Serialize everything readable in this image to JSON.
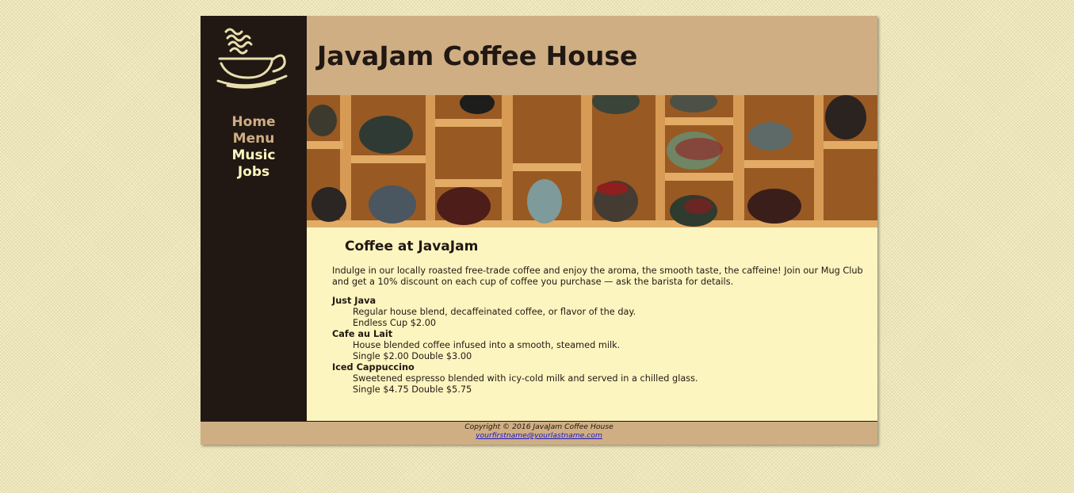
{
  "page": {
    "site_title": "JavaJam Coffee House"
  },
  "nav": {
    "items": [
      {
        "label": "Home",
        "state": "visited"
      },
      {
        "label": "Menu",
        "state": "visited"
      },
      {
        "label": "Music",
        "state": "unvisited"
      },
      {
        "label": "Jobs",
        "state": "unvisited"
      }
    ]
  },
  "hero": {
    "description": "mugs-on-wooden-shelves-photo"
  },
  "content": {
    "heading": "Coffee at JavaJam",
    "intro": "Indulge in our locally roasted free-trade coffee and enjoy the aroma, the smooth taste, the caffeine! Join our Mug Club and get a 10% discount on each cup of coffee you purchase — ask the barista for details.",
    "menu": [
      {
        "name": "Just Java",
        "description": "Regular house blend, decaffeinated coffee, or flavor of the day.",
        "price": "Endless Cup $2.00"
      },
      {
        "name": "Cafe au Lait",
        "description": "House blended coffee infused into a smooth, steamed milk.",
        "price": "Single $2.00 Double $3.00"
      },
      {
        "name": "Iced Cappuccino",
        "description": "Sweetened espresso blended with icy-cold milk and served in a chilled glass.",
        "price": "Single $4.75 Double $5.75"
      }
    ]
  },
  "footer": {
    "copyright": "Copyright © 2016 JavaJam Coffee House",
    "email": "yourfirstname@yourlastname.com"
  },
  "colors": {
    "background": "#f3ecc4",
    "sidebar": "#211813",
    "header": "#cfae83",
    "content": "#fdf5c0",
    "nav_visited": "#cfae83",
    "nav_unvisited": "#fdf5c0",
    "link": "#1a17c9"
  }
}
